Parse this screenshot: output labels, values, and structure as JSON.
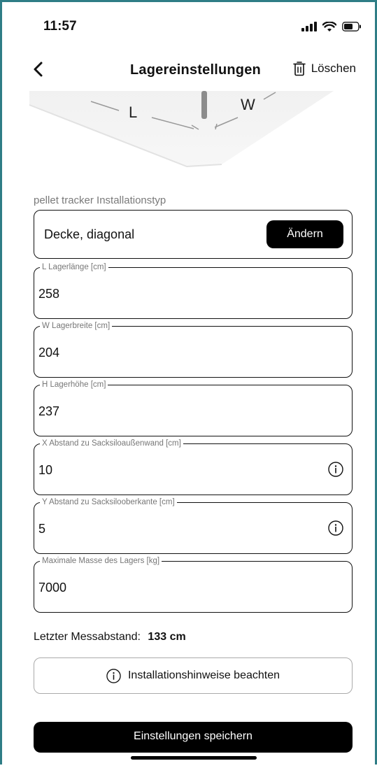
{
  "status_bar": {
    "time": "11:57"
  },
  "nav": {
    "title": "Lagereinstellungen",
    "delete_label": "Löschen"
  },
  "illustration": {
    "label_l": "L",
    "label_w": "W"
  },
  "installation": {
    "section_label": "pellet tracker Installationstyp",
    "value": "Decke, diagonal",
    "change_label": "Ändern"
  },
  "fields": [
    {
      "label": "L Lagerlänge [cm]",
      "value": "258",
      "info": false
    },
    {
      "label": "W Lagerbreite [cm]",
      "value": "204",
      "info": false
    },
    {
      "label": "H Lagerhöhe [cm]",
      "value": "237",
      "info": false
    },
    {
      "label": "X Abstand zu Sacksiloaußenwand [cm]",
      "value": "10",
      "info": true
    },
    {
      "label": "Y Abstand zu Sacksilooberkante [cm]",
      "value": "5",
      "info": true
    },
    {
      "label": "Maximale Masse des Lagers [kg]",
      "value": "7000",
      "info": false
    }
  ],
  "last_measure": {
    "label": "Letzter Messabstand:",
    "value": "133 cm"
  },
  "hint_button": {
    "label": "Installationshinweise beachten"
  },
  "save_button": {
    "label": "Einstellungen speichern"
  }
}
